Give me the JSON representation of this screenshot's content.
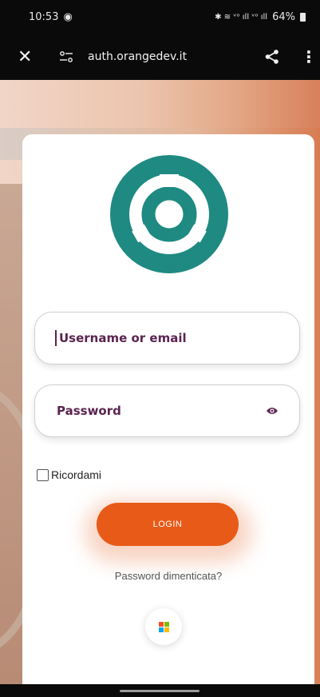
{
  "status": {
    "time": "10:53",
    "indicators": "✱ ≋ ᵛᵒ ıll ᵛᵒ ıll",
    "battery": "64%"
  },
  "browser": {
    "url": "auth.orangedev.it"
  },
  "login": {
    "username_placeholder": "Username or email",
    "password_placeholder": "Password",
    "remember_label": "Ricordami",
    "login_button": "LOGIN",
    "forgot_link": "Password dimenticata?"
  },
  "colors": {
    "brand_teal": "#1f8a82",
    "accent_orange": "#e85a17",
    "label_purple": "#5a2450"
  },
  "icons": {
    "close": "close-icon",
    "site_settings": "tune-icon",
    "share": "share-icon",
    "more": "more-vertical-icon",
    "password_toggle": "eye-icon",
    "microsoft": "microsoft-logo-icon"
  }
}
